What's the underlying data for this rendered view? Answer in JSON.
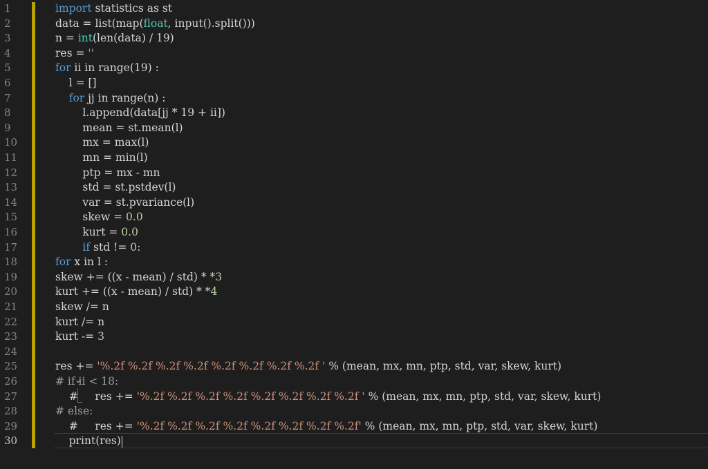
{
  "editor": {
    "active_line": 30,
    "line_numbers": [
      "1",
      "2",
      "3",
      "4",
      "5",
      "6",
      "7",
      "8",
      "9",
      "10",
      "11",
      "12",
      "13",
      "14",
      "15",
      "16",
      "17",
      "18",
      "19",
      "20",
      "21",
      "22",
      "23",
      "24",
      "25",
      "26",
      "27",
      "28",
      "29",
      "30"
    ],
    "lines": [
      [
        {
          "c": "kw",
          "t": "import"
        },
        {
          "c": "",
          "t": " statistics as st"
        }
      ],
      [
        {
          "c": "",
          "t": "data = list(map("
        },
        {
          "c": "bi",
          "t": "float"
        },
        {
          "c": "",
          "t": ", input().split()))"
        }
      ],
      [
        {
          "c": "",
          "t": "n = "
        },
        {
          "c": "bi",
          "t": "int"
        },
        {
          "c": "",
          "t": "(len(data) / 19)"
        }
      ],
      [
        {
          "c": "",
          "t": "res = "
        },
        {
          "c": "str",
          "t": "''"
        }
      ],
      [
        {
          "c": "kw",
          "t": "for"
        },
        {
          "c": "",
          "t": " ii in range(19) :"
        }
      ],
      [
        {
          "c": "",
          "t": "    l = []"
        }
      ],
      [
        {
          "c": "",
          "t": "    "
        },
        {
          "c": "kw",
          "t": "for"
        },
        {
          "c": "",
          "t": " jj in range(n) :"
        }
      ],
      [
        {
          "c": "",
          "t": "        l.append(data[jj * 19 + ii])"
        }
      ],
      [
        {
          "c": "",
          "t": "        mean = st.mean(l)"
        }
      ],
      [
        {
          "c": "",
          "t": "        mx = max(l)"
        }
      ],
      [
        {
          "c": "",
          "t": "        mn = min(l)"
        }
      ],
      [
        {
          "c": "",
          "t": "        ptp = mx - mn"
        }
      ],
      [
        {
          "c": "",
          "t": "        std = st.pstdev(l)"
        }
      ],
      [
        {
          "c": "",
          "t": "        var = st.pvariance(l)"
        }
      ],
      [
        {
          "c": "",
          "t": "        skew = "
        },
        {
          "c": "num",
          "t": "0.0"
        }
      ],
      [
        {
          "c": "",
          "t": "        kurt = "
        },
        {
          "c": "num",
          "t": "0.0"
        }
      ],
      [
        {
          "c": "",
          "t": "        "
        },
        {
          "c": "kw",
          "t": "if"
        },
        {
          "c": "",
          "t": " std != "
        },
        {
          "c": "num",
          "t": "0"
        },
        {
          "c": "",
          "t": ":"
        }
      ],
      [
        {
          "c": "kw",
          "t": "for"
        },
        {
          "c": "",
          "t": " x in l :"
        }
      ],
      [
        {
          "c": "",
          "t": "skew += ((x - mean) / std) * *"
        },
        {
          "c": "num",
          "t": "3"
        }
      ],
      [
        {
          "c": "",
          "t": "kurt += ((x - mean) / std) * *"
        },
        {
          "c": "num",
          "t": "4"
        }
      ],
      [
        {
          "c": "",
          "t": "skew /= n"
        }
      ],
      [
        {
          "c": "",
          "t": "kurt /= n"
        }
      ],
      [
        {
          "c": "",
          "t": "kurt -= "
        },
        {
          "c": "num",
          "t": "3"
        }
      ],
      [
        {
          "c": "",
          "t": ""
        }
      ],
      [
        {
          "c": "",
          "t": "res += "
        },
        {
          "c": "str",
          "t": "'%.2f %.2f %.2f %.2f %.2f %.2f %.2f %.2f '"
        },
        {
          "c": "",
          "t": " % (mean, mx, mn, ptp, std, var, skew, kurt)"
        }
      ],
      [
        {
          "c": "cm",
          "t": "# if ii < 18:"
        }
      ],
      [
        {
          "c": "",
          "t": "    #     res += "
        },
        {
          "c": "str",
          "t": "'%.2f %.2f %.2f %.2f %.2f %.2f %.2f %.2f '"
        },
        {
          "c": "",
          "t": " % (mean, mx, mn, ptp, std, var, skew, kurt)"
        }
      ],
      [
        {
          "c": "cm",
          "t": "# else:"
        }
      ],
      [
        {
          "c": "",
          "t": "    #     res += "
        },
        {
          "c": "str",
          "t": "'%.2f %.2f %.2f %.2f %.2f %.2f %.2f %.2f'"
        },
        {
          "c": "",
          "t": " % (mean, mx, mn, ptp, std, var, skew, kurt)"
        }
      ],
      [
        {
          "c": "",
          "t": "    print(res)"
        }
      ]
    ],
    "fold_icon": "chevron-down-icon",
    "fold_line": 26,
    "colors": {
      "background": "#1e1e1e",
      "keyword": "#569cd6",
      "builtin": "#4ec9b0",
      "number": "#b5cea8",
      "string": "#ce9178",
      "comment": "#9a9a9a",
      "change_bar": "#b8a100"
    }
  }
}
